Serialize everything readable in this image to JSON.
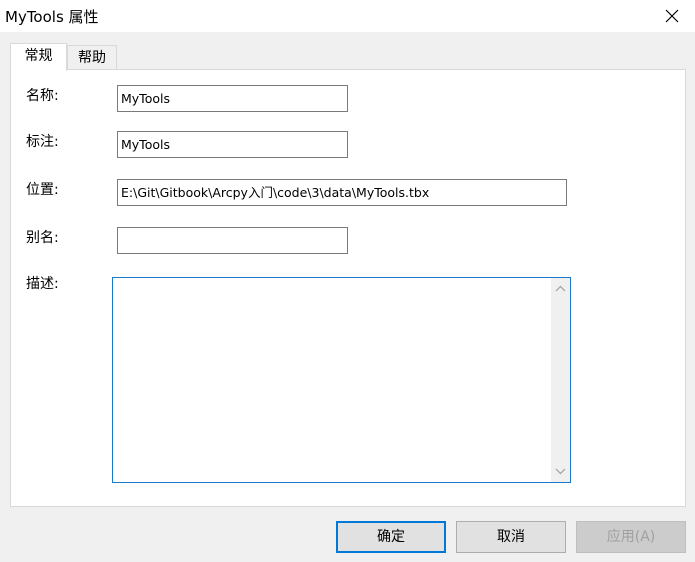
{
  "window": {
    "title": "MyTools 属性"
  },
  "tabs": [
    {
      "label": "常规",
      "active": true
    },
    {
      "label": "帮助",
      "active": false
    }
  ],
  "fields": {
    "name": {
      "label": "名称:",
      "value": "MyTools"
    },
    "alias_label": {
      "label": "标注:",
      "value": "MyTools"
    },
    "location": {
      "label": "位置:",
      "value": "E:\\Git\\Gitbook\\Arcpy入门\\code\\3\\data\\MyTools.tbx"
    },
    "alias": {
      "label": "别名:",
      "value": ""
    },
    "description": {
      "label": "描述:",
      "value": ""
    }
  },
  "buttons": {
    "ok": "确定",
    "cancel": "取消",
    "apply": "应用(A)"
  },
  "icons": {
    "close": "close-icon",
    "scroll_up": "chevron-up-icon",
    "scroll_down": "chevron-down-icon"
  },
  "colors": {
    "focus_border": "#1979ca",
    "default_button_border": "#0078d7"
  }
}
